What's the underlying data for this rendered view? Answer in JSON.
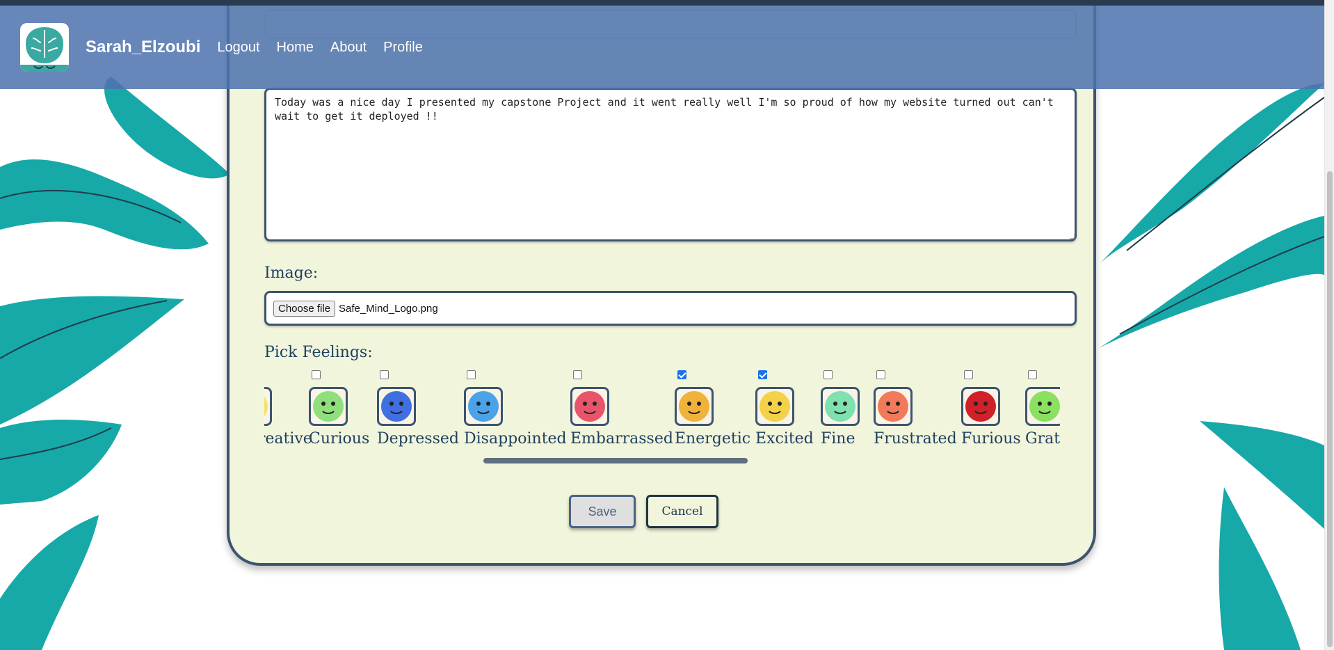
{
  "navbar": {
    "brand": "Sarah_Elzoubi",
    "links": [
      "Logout",
      "Home",
      "About",
      "Profile"
    ]
  },
  "journal": {
    "text": "Today was a nice day I presented my capstone Project and it went really well I'm so proud of how my website turned out can't wait to get it deployed !!"
  },
  "image_section": {
    "label": "Image:",
    "choose_button": "Choose file",
    "file_name": "Safe_Mind_Logo.png"
  },
  "feelings_section": {
    "label": "Pick Feelings:",
    "items": [
      {
        "name": "Creative",
        "checked": false,
        "color": "#f3e36a"
      },
      {
        "name": "Curious",
        "checked": false,
        "color": "#8fe07c"
      },
      {
        "name": "Depressed",
        "checked": false,
        "color": "#3f6fe0"
      },
      {
        "name": "Disappointed",
        "checked": false,
        "color": "#4aa3e8"
      },
      {
        "name": "Embarrassed",
        "checked": false,
        "color": "#e8556a"
      },
      {
        "name": "Energetic",
        "checked": true,
        "color": "#f0b23a"
      },
      {
        "name": "Excited",
        "checked": true,
        "color": "#f3d24a"
      },
      {
        "name": "Fine",
        "checked": false,
        "color": "#7fe0b0"
      },
      {
        "name": "Frustrated",
        "checked": false,
        "color": "#f07a5a"
      },
      {
        "name": "Furious",
        "checked": false,
        "color": "#d0202a"
      },
      {
        "name": "Grateful",
        "checked": false,
        "color": "#8ae060"
      }
    ]
  },
  "actions": {
    "save": "Save",
    "cancel": "Cancel"
  },
  "colors": {
    "navbar": "#4e72af",
    "card_bg": "#f1f5dc",
    "border": "#3c5470",
    "leaf": "#16a9a8"
  }
}
